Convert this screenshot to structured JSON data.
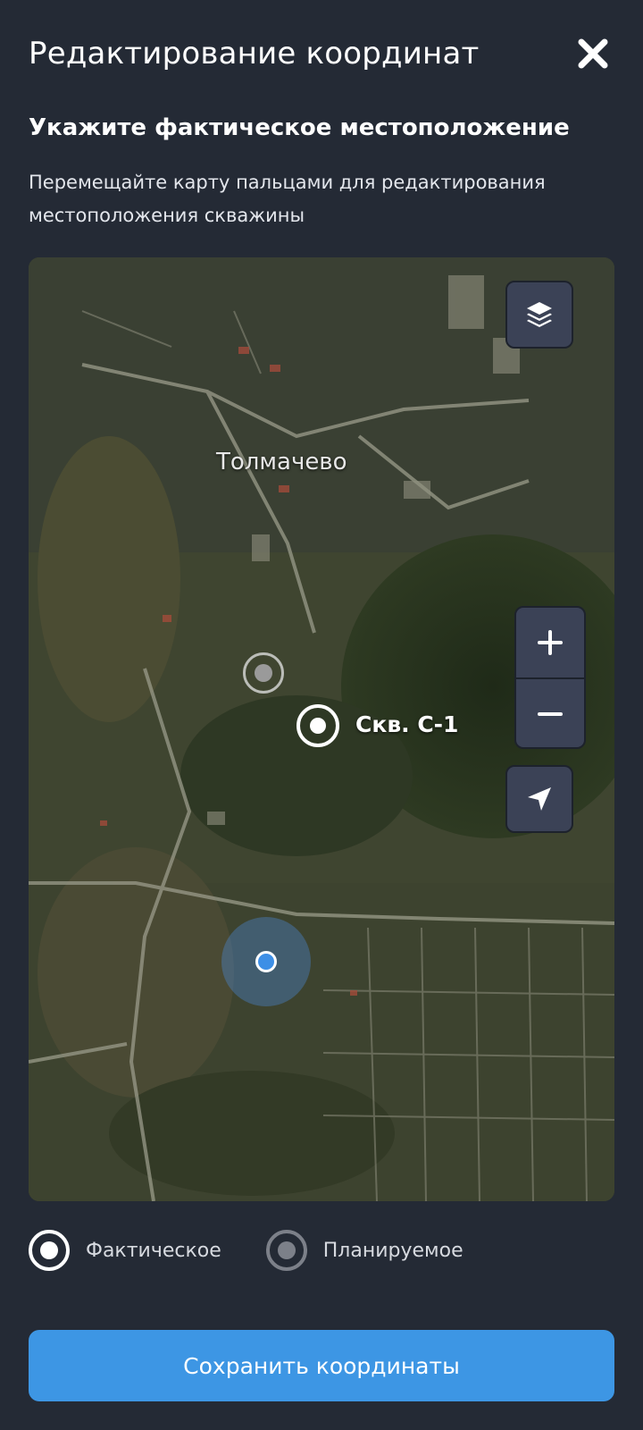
{
  "header": {
    "title": "Редактирование координат",
    "close_icon": "close-icon"
  },
  "instructions": {
    "subtitle": "Укажите фактическое местоположение",
    "description": "Перемещайте карту пальцами для редактирования местоположения скважины"
  },
  "map": {
    "place_label": "Толмачево",
    "well_label": "Скв. С-1",
    "controls": {
      "layers_icon": "layers-icon",
      "zoom_in_icon": "plus-icon",
      "zoom_out_icon": "minus-icon",
      "locate_icon": "navigation-arrow-icon"
    }
  },
  "location_type": {
    "options": [
      {
        "label": "Фактическое",
        "selected": true
      },
      {
        "label": "Планируемое",
        "selected": false
      }
    ]
  },
  "save_button": {
    "label": "Сохранить координаты"
  },
  "colors": {
    "background": "#242a35",
    "accent": "#3d96e4",
    "control": "#3b4256"
  }
}
